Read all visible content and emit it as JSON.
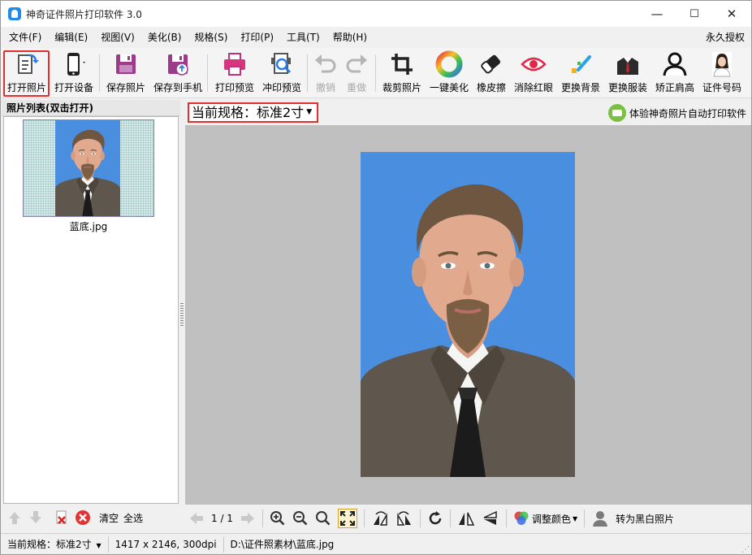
{
  "window": {
    "title": "神奇证件照片打印软件 3.0",
    "minimize": "—",
    "maximize": "☐",
    "close": "✕"
  },
  "menu": {
    "items": [
      "文件(F)",
      "编辑(E)",
      "视图(V)",
      "美化(B)",
      "规格(S)",
      "打印(P)",
      "工具(T)",
      "帮助(H)"
    ],
    "license": "永久授权"
  },
  "toolbar": {
    "open_photo": "打开照片",
    "open_device": "打开设备",
    "save_photo": "保存照片",
    "save_to_phone": "保存到手机",
    "print_preview": "打印预览",
    "develop_preview": "冲印预览",
    "undo": "撤销",
    "redo": "重做",
    "crop": "裁剪照片",
    "beautify": "一键美化",
    "eraser": "橡皮擦",
    "red_eye": "消除红眼",
    "change_bg": "更换背景",
    "change_clothes": "更换服装",
    "fix_shoulder": "矫正肩高",
    "id_number": "证件号码"
  },
  "left_panel": {
    "header": "照片列表(双击打开)",
    "thumb_name": "蓝底.jpg",
    "clear": "清空",
    "select_all": "全选"
  },
  "main": {
    "spec_label": "当前规格：标准2寸",
    "promo": "体验神奇照片自动打印软件",
    "photo_bg_color": "#4a8fdf"
  },
  "bottom_tools": {
    "page": "1 / 1",
    "adjust_color": "调整颜色",
    "to_bw": "转为黑白照片"
  },
  "status": {
    "spec": "当前规格：标准2寸",
    "dims": "1417 x 2146, 300dpi",
    "path": "D:\\证件照素材\\蓝底.jpg"
  }
}
